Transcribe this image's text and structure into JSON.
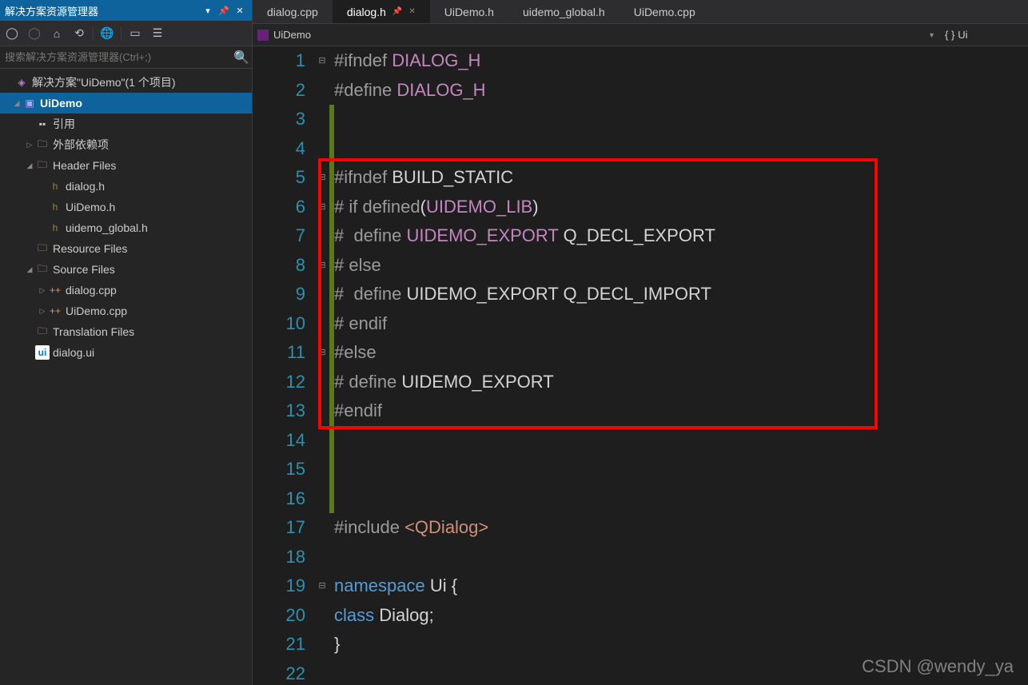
{
  "panel": {
    "title": "解决方案资源管理器",
    "search_placeholder": "搜索解决方案资源管理器(Ctrl+;)"
  },
  "tree": {
    "solution": "解决方案\"UiDemo\"(1 个项目)",
    "project": "UiDemo",
    "refs": "引用",
    "ext_deps": "外部依赖项",
    "header_files": "Header Files",
    "h1": "dialog.h",
    "h2": "UiDemo.h",
    "h3": "uidemo_global.h",
    "resource_files": "Resource Files",
    "source_files": "Source Files",
    "s1": "dialog.cpp",
    "s2": "UiDemo.cpp",
    "translation_files": "Translation Files",
    "ui1": "dialog.ui"
  },
  "tabs": [
    {
      "label": "dialog.cpp"
    },
    {
      "label": "dialog.h",
      "active": true
    },
    {
      "label": "UiDemo.h"
    },
    {
      "label": "uidemo_global.h"
    },
    {
      "label": "UiDemo.cpp"
    }
  ],
  "navbar": {
    "left": "UiDemo",
    "right": "Ui"
  },
  "code_lines": [
    {
      "n": 1,
      "fold": "fm",
      "ch": false,
      "html": "<span class='pp'>#ifndef</span> <span class='mac'>DIALOG_H</span>"
    },
    {
      "n": 2,
      "fold": "",
      "ch": false,
      "html": "<span class='pp'>#define</span> <span class='mac'>DIALOG_H</span>"
    },
    {
      "n": 3,
      "fold": "",
      "ch": true,
      "html": ""
    },
    {
      "n": 4,
      "fold": "",
      "ch": true,
      "html": ""
    },
    {
      "n": 5,
      "fold": "fm",
      "ch": true,
      "html": "<span class='pp'>#ifndef</span> <span class='macw'>BUILD_STATIC</span>"
    },
    {
      "n": 6,
      "fold": "fm",
      "ch": true,
      "html": "<span class='pp'># if defined</span><span class='pun'>(</span><span class='mac'>UIDEMO_LIB</span><span class='pun'>)</span>"
    },
    {
      "n": 7,
      "fold": "",
      "ch": true,
      "html": "<span class='pp'>#  define</span> <span class='mac'>UIDEMO_EXPORT</span> <span class='macw'>Q_DECL_EXPORT</span>"
    },
    {
      "n": 8,
      "fold": "fm",
      "ch": true,
      "html": "<span class='pp'># else</span>"
    },
    {
      "n": 9,
      "fold": "",
      "ch": true,
      "html": "<span class='pp'>#  define</span> <span class='macw'>UIDEMO_EXPORT Q_DECL_IMPORT</span>"
    },
    {
      "n": 10,
      "fold": "",
      "ch": true,
      "html": "<span class='pp'># endif</span>"
    },
    {
      "n": 11,
      "fold": "fm",
      "ch": true,
      "html": "<span class='pp'>#else</span>"
    },
    {
      "n": 12,
      "fold": "",
      "ch": true,
      "html": "<span class='pp'># define</span> <span class='macw'>UIDEMO_EXPORT</span>"
    },
    {
      "n": 13,
      "fold": "",
      "ch": true,
      "html": "<span class='pp'>#endif</span>"
    },
    {
      "n": 14,
      "fold": "",
      "ch": true,
      "html": ""
    },
    {
      "n": 15,
      "fold": "",
      "ch": true,
      "html": ""
    },
    {
      "n": 16,
      "fold": "",
      "ch": true,
      "html": ""
    },
    {
      "n": 17,
      "fold": "",
      "ch": false,
      "html": "<span class='pp'>#include</span> <span class='ang'>&lt;QDialog&gt;</span>"
    },
    {
      "n": 18,
      "fold": "",
      "ch": false,
      "html": ""
    },
    {
      "n": 19,
      "fold": "fm",
      "ch": false,
      "html": "<span class='ns'>namespace</span> <span class='id'>Ui</span> <span class='pun'>{</span>"
    },
    {
      "n": 20,
      "fold": "",
      "ch": false,
      "html": "<span class='cls'>class</span> <span class='id'>Dialog</span><span class='pun'>;</span>"
    },
    {
      "n": 21,
      "fold": "",
      "ch": false,
      "html": "<span class='pun'>}</span>"
    },
    {
      "n": 22,
      "fold": "",
      "ch": false,
      "html": ""
    }
  ],
  "highlight": {
    "top_line": 5,
    "bottom_line": 13
  },
  "watermark": "CSDN @wendy_ya"
}
